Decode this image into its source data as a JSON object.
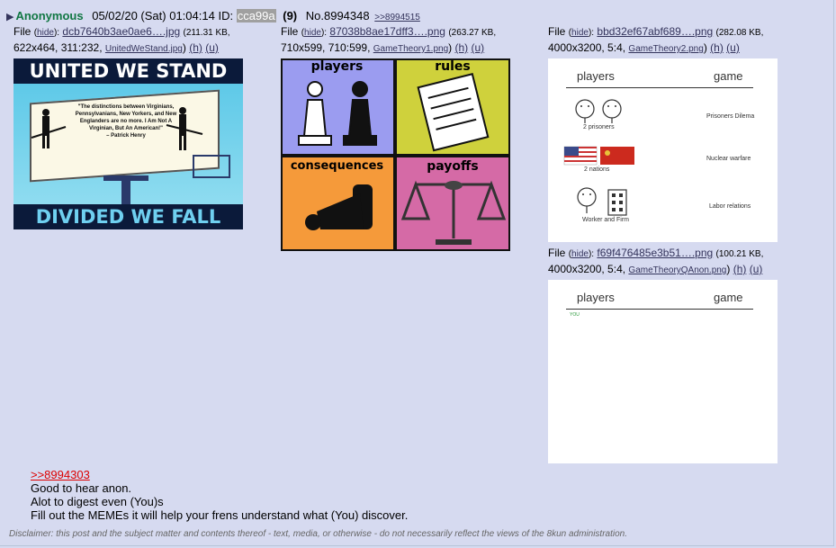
{
  "post": {
    "name": "Anonymous",
    "date": "05/02/20 (Sat) 01:04:14",
    "id_label": "ID:",
    "id_value": "cca99a",
    "id_count": "(9)",
    "postno": "No.8994348",
    "backlink": ">>8994515"
  },
  "files": [
    {
      "label": "File",
      "hide": "hide",
      "filename": "dcb7640b3ae0ae6….jpg",
      "size": "(211.31 KB,",
      "meta": "622x464, 311:232,",
      "orig": "UnitedWeStand.jpg",
      "h": "(h)",
      "u": "(u)",
      "top_text": "UNITED WE STAND",
      "bottom_text": "DIVIDED WE FALL",
      "quote": "\"The distinctions between Virginians, Pennsylvanians, New Yorkers, and New Englanders are no more. I Am Not A Virginian, But An American!\"",
      "attribution": "– Patrick Henry"
    },
    {
      "label": "File",
      "hide": "hide",
      "filename": "87038b8ae17dff3….png",
      "size": "(263.27 KB,",
      "meta": "710x599, 710:599,",
      "orig": "GameTheory1.png",
      "h": "(h)",
      "u": "(u)",
      "quad_labels": [
        "players",
        "rules",
        "consequences",
        "payoffs"
      ]
    },
    {
      "label": "File",
      "hide": "hide",
      "filename": "bbd32ef67abf689….png",
      "size": "(282.08 KB,",
      "meta": "4000x3200, 5:4,",
      "orig": "GameTheory2.png",
      "h": "(h)",
      "u": "(u)",
      "col_left": "players",
      "col_right": "game",
      "rows": [
        {
          "left": "2 prisoners",
          "right": "Prisoners Dilema"
        },
        {
          "left": "2 nations",
          "right": "Nuclear warfare"
        },
        {
          "left": "Worker and Firm",
          "right": "Labor relations"
        }
      ]
    },
    {
      "label": "File",
      "hide": "hide",
      "filename": "f69f476485e3b51….png",
      "size": "(100.21 KB,",
      "meta": "4000x3200, 5:4,",
      "orig": "GameTheoryQAnon.png",
      "h": "(h)",
      "u": "(u)",
      "col_left": "players",
      "col_right": "game",
      "you": "YOU"
    }
  ],
  "body": {
    "quotelink": ">>8994303",
    "lines": [
      "Good to hear anon.",
      "Alot to digest even (You)s",
      "Fill out the MEMEs it will help your frens understand what (You) discover."
    ]
  },
  "disclaimer": "Disclaimer: this post and the subject matter and contents thereof - text, media, or otherwise - do not necessarily reflect the views of the 8kun administration.",
  "colors": {
    "background": "#d6daf0",
    "name": "#117743",
    "link": "#34345c",
    "quotelink": "#dd0000"
  }
}
